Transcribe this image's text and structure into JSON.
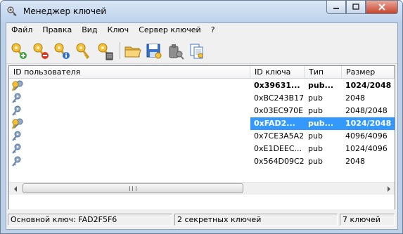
{
  "window": {
    "title": "Менеджер ключей"
  },
  "menu": [
    "Файл",
    "Правка",
    "Вид",
    "Ключ",
    "Сервер ключей",
    "?"
  ],
  "toolbar": {
    "buttons": [
      "new-key",
      "delete-key",
      "key-info",
      "sign-key",
      "key-server",
      "open-file",
      "save-file",
      "export-key",
      "import-key"
    ]
  },
  "list": {
    "columns": [
      "ID пользователя",
      "ID ключа",
      "Тип",
      "Размер"
    ],
    "rows": [
      {
        "user_id": "",
        "key_id": "0x39631...",
        "type": "pub...",
        "size": "1024/2048",
        "icon": "keypair-icon",
        "bold": true,
        "selected": false
      },
      {
        "user_id": "",
        "key_id": "0xBC243B17",
        "type": "pub",
        "size": "2048",
        "icon": "public-key-icon",
        "bold": false,
        "selected": false
      },
      {
        "user_id": "",
        "key_id": "0x03EC970E",
        "type": "pub",
        "size": "2048/2048",
        "icon": "public-key-icon",
        "bold": false,
        "selected": false
      },
      {
        "user_id": "",
        "key_id": "0xFAD2...",
        "type": "pub...",
        "size": "1024/2048",
        "icon": "keypair-icon",
        "bold": true,
        "selected": true
      },
      {
        "user_id": "",
        "key_id": "0x7CE3A5A2",
        "type": "pub",
        "size": "4096/4096",
        "icon": "public-key-icon",
        "bold": false,
        "selected": false
      },
      {
        "user_id": "",
        "key_id": "0xE1DEEC...",
        "type": "pub",
        "size": "1024/4096",
        "icon": "public-key-icon",
        "bold": false,
        "selected": false
      },
      {
        "user_id": "",
        "key_id": "0x564D09C2",
        "type": "pub",
        "size": "2048",
        "icon": "public-key-icon",
        "bold": false,
        "selected": false
      }
    ]
  },
  "status": {
    "default_key": "Основной ключ: FAD2F5F6",
    "secret_keys": "2 секретных ключей",
    "total_keys": "7 ключей"
  },
  "colors": {
    "selection": "#3399ff",
    "title_gradient_top": "#d9e6f5",
    "close_button": "#c8452d"
  }
}
